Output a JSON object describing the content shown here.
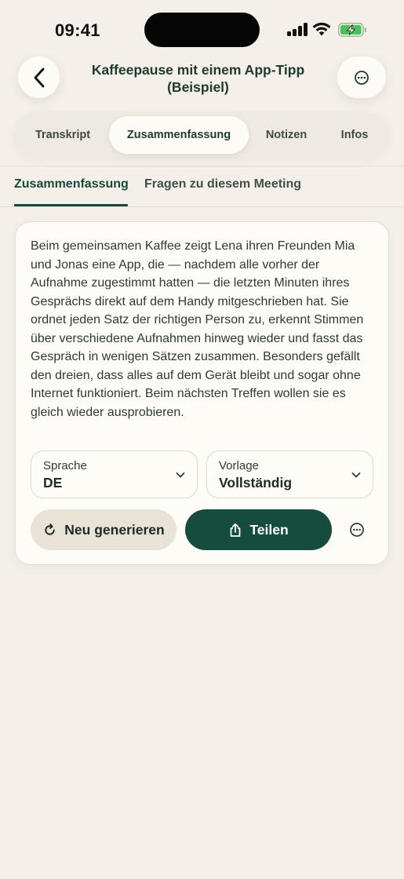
{
  "status_bar": {
    "time": "09:41",
    "icons": [
      "cellular-signal-icon",
      "wifi-icon",
      "battery-charging-icon"
    ],
    "battery_color": "#48c15a"
  },
  "header": {
    "title_line1": "Kaffeepause mit einem App-Tipp",
    "title_line2": "(Beispiel)",
    "back_icon": "chevron-left-icon",
    "more_icon": "ellipsis-circle-icon"
  },
  "tabs": [
    {
      "label": "Transkript",
      "active": false
    },
    {
      "label": "Zusammenfassung",
      "active": true
    },
    {
      "label": "Notizen",
      "active": false
    },
    {
      "label": "Infos",
      "active": false
    }
  ],
  "subtabs": [
    {
      "label": "Zusammenfassung",
      "active": true
    },
    {
      "label": "Fragen zu diesem Meeting",
      "active": false
    }
  ],
  "card": {
    "summary_text": "Beim gemeinsamen Kaffee zeigt Lena ihren Freunden Mia und Jonas eine App, die — nachdem alle vorher der Aufnahme zugestimmt hatten — die letzten Minuten ihres Gesprächs direkt auf dem Handy mitgeschrieben hat. Sie ordnet jeden Satz der richtigen Person zu, erkennt Stimmen über verschiedene Aufnahmen hinweg wieder und fasst das Gespräch in wenigen Sätzen zusammen. Besonders gefällt den dreien, dass alles auf dem Gerät bleibt und sogar ohne Internet funktioniert. Beim nächsten Treffen wollen sie es gleich wieder ausprobieren.",
    "language": {
      "label": "Sprache",
      "value": "DE"
    },
    "template": {
      "label": "Vorlage",
      "value": "Vollständig"
    },
    "regenerate_label": "Neu generieren",
    "share_label": "Teilen"
  },
  "colors": {
    "background": "#f4f0e9",
    "accent": "#154c3d",
    "card": "#fefcf7"
  }
}
